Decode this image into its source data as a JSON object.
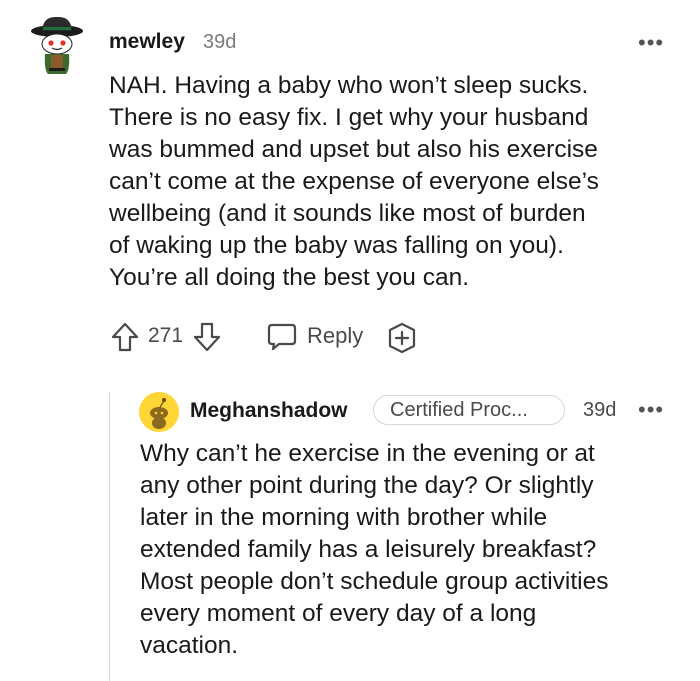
{
  "comment": {
    "username": "mewley",
    "age": "39d",
    "more_label": "•••",
    "body_lines": [
      "NAH. Having a baby who won’t sleep sucks.",
      "There is no easy fix. I get why your husband",
      "was bummed and upset but also his exercise",
      "can’t come at the expense of everyone else’s",
      "wellbeing (and it sounds like most of burden",
      "of waking up the baby was falling on you).",
      "You’re all doing the best you can."
    ],
    "score": "271",
    "reply_label": "Reply"
  },
  "reply": {
    "username": "Meghanshadow",
    "flair": "Certified Proc...",
    "age": "39d",
    "more_label": "•••",
    "body_lines": [
      "Why can’t he exercise in the evening or at",
      "any other point during the day? Or slightly",
      "later in the morning with brother while",
      "extended family has a leisurely breakfast?",
      "Most people don’t schedule group activities",
      "every moment of every day of a long",
      "vacation."
    ]
  },
  "colors": {
    "text": "#1a1a1b",
    "meta": "#7c7c7c",
    "icon": "#4a4a4a",
    "avatar_bg": "#ffd635"
  },
  "icons": [
    "snoo-avatar-icon",
    "upvote-icon",
    "downvote-icon",
    "reply-bubble-icon",
    "award-plus-icon",
    "snoo-yellow-avatar-icon"
  ]
}
